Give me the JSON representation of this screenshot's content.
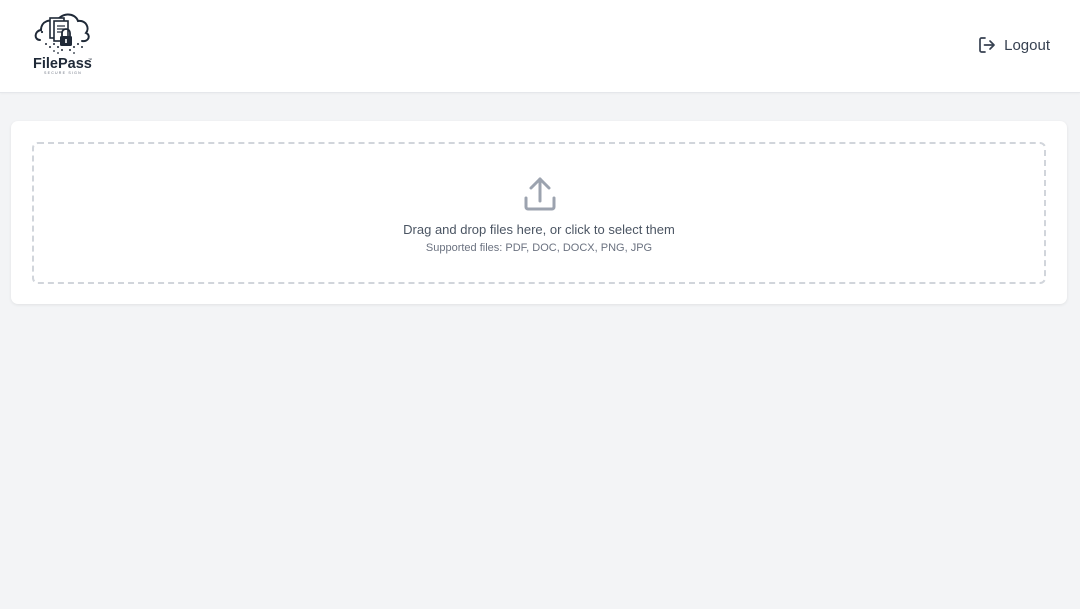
{
  "header": {
    "logo": {
      "icon": "filepass-cloud-lock-logo",
      "name": "FilePass",
      "tagline": "SECURE SIGN"
    },
    "logout": {
      "icon": "logout-icon",
      "label": "Logout"
    }
  },
  "upload": {
    "icon": "upload-icon",
    "primary_text": "Drag and drop files here, or click to select them",
    "secondary_text": "Supported files: PDF, DOC, DOCX, PNG, JPG"
  },
  "colors": {
    "page_background": "#f3f4f6",
    "card_background": "#ffffff",
    "dropzone_border": "#d1d5db",
    "icon": "#9ca3af",
    "logo": "#1f2937"
  }
}
